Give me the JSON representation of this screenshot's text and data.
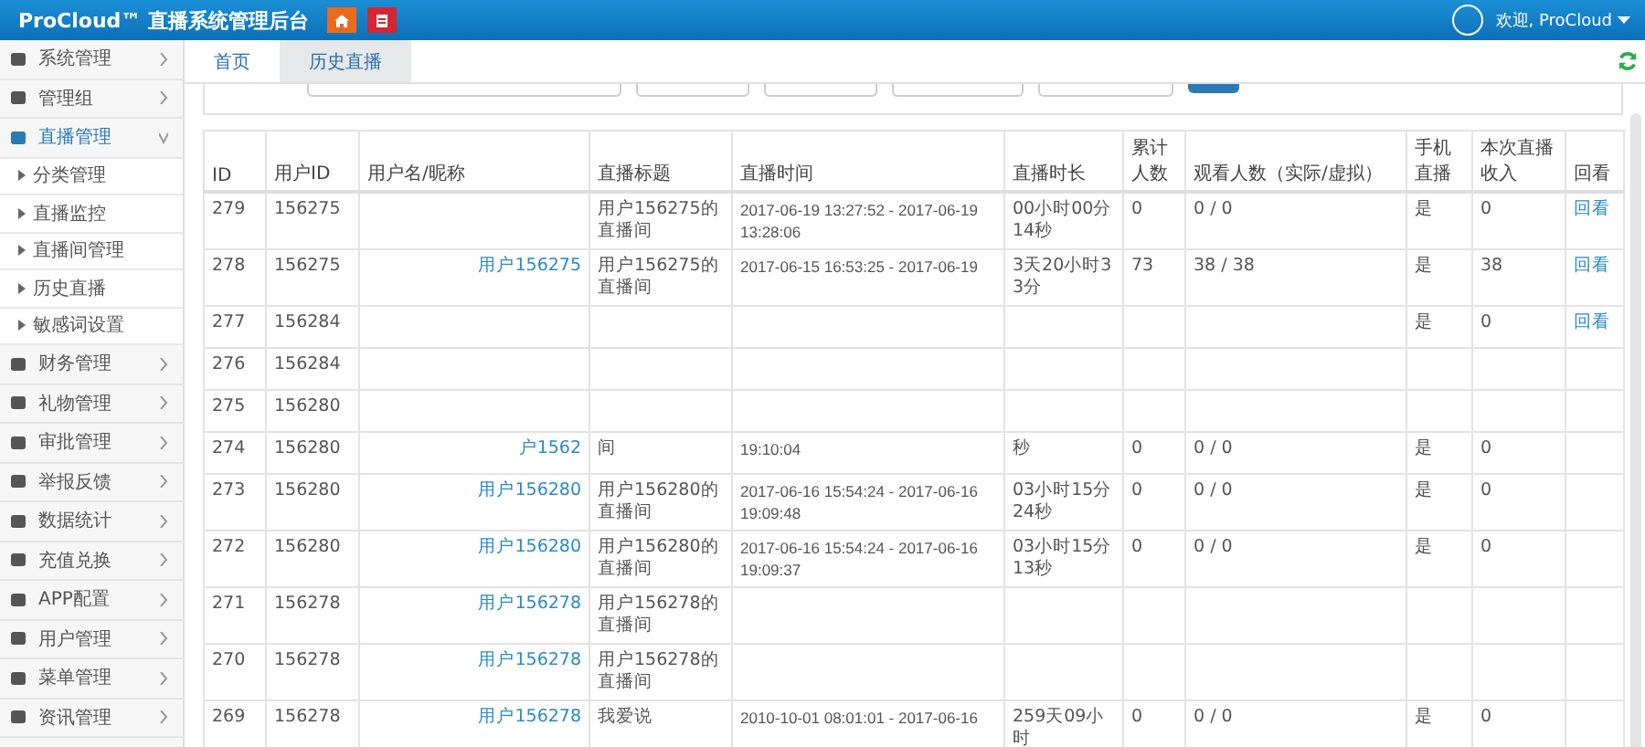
{
  "header": {
    "title": "ProCloud™ 直播系统管理后台",
    "welcome": "欢迎, ProCloud"
  },
  "sidebar": {
    "items": [
      {
        "label": "系统管理",
        "selected": false,
        "expanded": false
      },
      {
        "label": "管理组",
        "selected": false,
        "expanded": false
      },
      {
        "label": "直播管理",
        "selected": true,
        "expanded": true,
        "children": [
          {
            "label": "分类管理"
          },
          {
            "label": "直播监控"
          },
          {
            "label": "直播间管理"
          },
          {
            "label": "历史直播"
          },
          {
            "label": "敏感词设置"
          }
        ]
      },
      {
        "label": "财务管理",
        "selected": false,
        "expanded": false
      },
      {
        "label": "礼物管理",
        "selected": false,
        "expanded": false
      },
      {
        "label": "审批管理",
        "selected": false,
        "expanded": false
      },
      {
        "label": "举报反馈",
        "selected": false,
        "expanded": false
      },
      {
        "label": "数据统计",
        "selected": false,
        "expanded": false
      },
      {
        "label": "充值兑换",
        "selected": false,
        "expanded": false
      },
      {
        "label": "APP配置",
        "selected": false,
        "expanded": false
      },
      {
        "label": "用户管理",
        "selected": false,
        "expanded": false
      },
      {
        "label": "菜单管理",
        "selected": false,
        "expanded": false
      },
      {
        "label": "资讯管理",
        "selected": false,
        "expanded": false
      }
    ]
  },
  "tabs": [
    {
      "label": "首页",
      "selected": false
    },
    {
      "label": "历史直播",
      "selected": true
    }
  ],
  "table": {
    "columns": [
      "ID",
      "用户ID",
      "用户名/昵称",
      "直播标题",
      "直播时间",
      "直播时长",
      "累计人数",
      "观看人数（实际/虚拟）",
      "手机直播",
      "本次直播收入",
      "回看"
    ],
    "rows": [
      {
        "id": "279",
        "user_id": "156275",
        "title": "用户156275的直播间",
        "time": "2017-06-19 13:27:52 - 2017-06-19 13:28:06",
        "duration": "00小时00分14秒",
        "total": "0",
        "viewers": "0 / 0",
        "mobile": "是",
        "income": "0",
        "replay": "回看"
      },
      {
        "id": "278",
        "user_id": "156275",
        "name": "用户156275",
        "title": "用户156275的直播间",
        "time": "2017-06-15 16:53:25 - 2017-06-19",
        "duration": "3天20小时33分",
        "total": "73",
        "viewers": "38 / 38",
        "mobile": "是",
        "income": "38",
        "replay": "回看"
      },
      {
        "id": "277",
        "user_id": "156284",
        "mobile": "是",
        "income": "0",
        "replay": "回看"
      },
      {
        "id": "276",
        "user_id": "156284"
      },
      {
        "id": "275",
        "user_id": "156280"
      },
      {
        "id": "274",
        "user_id": "156280",
        "name": "户1562",
        "title": "间",
        "time": "19:10:04",
        "duration": "秒",
        "total": "0",
        "viewers": "0 / 0",
        "mobile": "是",
        "income": "0"
      },
      {
        "id": "273",
        "user_id": "156280",
        "name": "用户156280",
        "title": "用户156280的直播间",
        "time": "2017-06-16 15:54:24 - 2017-06-16 19:09:48",
        "duration": "03小时15分24秒",
        "total": "0",
        "viewers": "0 / 0",
        "mobile": "是",
        "income": "0"
      },
      {
        "id": "272",
        "user_id": "156280",
        "name": "用户156280",
        "title": "用户156280的直播间",
        "time": "2017-06-16 15:54:24 - 2017-06-16 19:09:37",
        "duration": "03小时15分13秒",
        "total": "0",
        "viewers": "0 / 0",
        "mobile": "是",
        "income": "0"
      },
      {
        "id": "271",
        "user_id": "156278",
        "name": "用户156278",
        "title": "用户156278的直播间"
      },
      {
        "id": "270",
        "user_id": "156278",
        "name": "用户156278",
        "title": "用户156278的直播间"
      },
      {
        "id": "269",
        "user_id": "156278",
        "name": "用户156278",
        "title": "我爱说",
        "time": "2010-10-01 08:01:01 - 2017-06-16",
        "duration": "259天09小时",
        "total": "0",
        "viewers": "0 / 0",
        "mobile": "是",
        "income": "0"
      }
    ]
  }
}
